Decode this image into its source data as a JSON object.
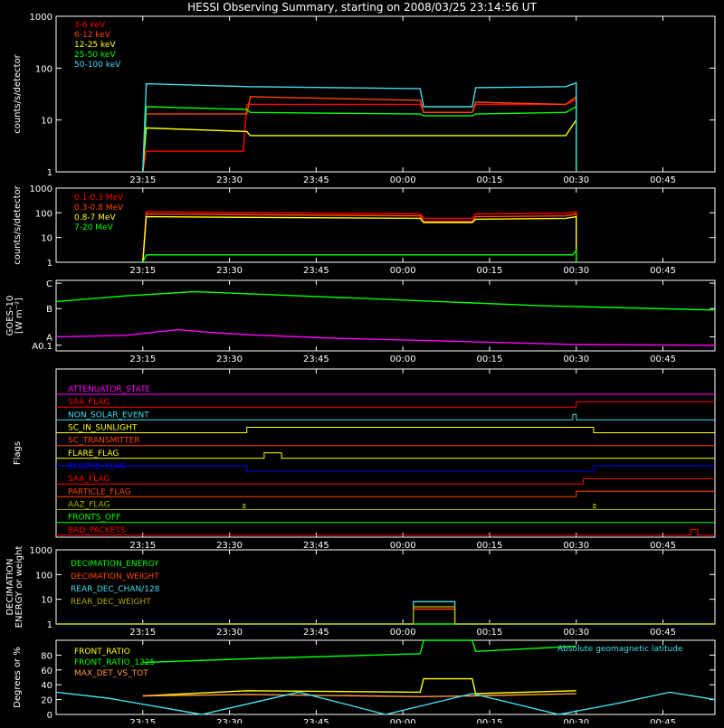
{
  "title": "HESSI Observing Summary, starting on 2008/03/25 23:14:56 UT",
  "colors": {
    "bg": "#000000",
    "axis": "#ffffff",
    "red": "#ff0000",
    "orange": "#ff6a00",
    "yellow": "#ffff00",
    "green": "#00ff00",
    "cyan": "#44ddee",
    "magenta": "#ff00ff",
    "blue": "#0000ff",
    "darkorange": "#ff4400",
    "olive": "#aaaa00",
    "brown": "#cc6600",
    "peach": "#ff9944"
  },
  "time_ticks": [
    "23:15",
    "23:30",
    "23:45",
    "00:00",
    "00:15",
    "00:30",
    "00:45"
  ],
  "chart_data": [
    {
      "type": "line",
      "panel": "lightcurves",
      "ylabel": "counts/s/detector",
      "yscale": "log",
      "ylim": [
        1,
        1000
      ],
      "y_ticks": [
        "1",
        "10",
        "100",
        "1000"
      ],
      "legend_position": "top-left",
      "series": [
        {
          "name": "3-6 keV",
          "color": "red",
          "points": [
            [
              23.25,
              1
            ],
            [
              23.26,
              2.5
            ],
            [
              23.54,
              2.5
            ],
            [
              23.55,
              20
            ],
            [
              24.05,
              20
            ],
            [
              24.06,
              14
            ],
            [
              24.2,
              14
            ],
            [
              24.21,
              20
            ],
            [
              24.47,
              20
            ],
            [
              24.5,
              25
            ],
            [
              24.5,
              1
            ]
          ]
        },
        {
          "name": "6-12 keV",
          "color": "darkorange",
          "points": [
            [
              23.25,
              1
            ],
            [
              23.26,
              13
            ],
            [
              23.55,
              13
            ],
            [
              23.56,
              28
            ],
            [
              24.05,
              24
            ],
            [
              24.06,
              14
            ],
            [
              24.2,
              14
            ],
            [
              24.21,
              22
            ],
            [
              24.47,
              20
            ],
            [
              24.5,
              28
            ],
            [
              24.5,
              1
            ]
          ]
        },
        {
          "name": "12-25 keV",
          "color": "yellow",
          "points": [
            [
              23.25,
              1
            ],
            [
              23.26,
              7
            ],
            [
              23.55,
              6
            ],
            [
              23.56,
              5
            ],
            [
              24.05,
              5
            ],
            [
              24.2,
              5
            ],
            [
              24.47,
              5
            ],
            [
              24.5,
              10
            ],
            [
              24.5,
              1
            ]
          ]
        },
        {
          "name": "25-50 keV",
          "color": "green",
          "points": [
            [
              23.25,
              1
            ],
            [
              23.26,
              18
            ],
            [
              23.55,
              16
            ],
            [
              23.56,
              14
            ],
            [
              24.05,
              13
            ],
            [
              24.06,
              12
            ],
            [
              24.2,
              12
            ],
            [
              24.21,
              13
            ],
            [
              24.47,
              14
            ],
            [
              24.5,
              18
            ],
            [
              24.5,
              1
            ]
          ]
        },
        {
          "name": "50-100 keV",
          "color": "cyan",
          "points": [
            [
              23.25,
              1
            ],
            [
              23.26,
              50
            ],
            [
              23.55,
              44
            ],
            [
              24.05,
              40
            ],
            [
              24.06,
              18
            ],
            [
              24.2,
              18
            ],
            [
              24.21,
              42
            ],
            [
              24.47,
              44
            ],
            [
              24.5,
              52
            ],
            [
              24.5,
              1
            ]
          ]
        }
      ]
    },
    {
      "type": "line",
      "panel": "high-energy",
      "ylabel": "counts/s/detector",
      "yscale": "log",
      "ylim": [
        1,
        1000
      ],
      "y_ticks": [
        "1",
        "10",
        "100",
        "1000"
      ],
      "legend_position": "top-left",
      "series": [
        {
          "name": "0.1-0.3 MeV",
          "color": "red",
          "points": [
            [
              23.25,
              1
            ],
            [
              23.26,
              110
            ],
            [
              24.05,
              90
            ],
            [
              24.06,
              60
            ],
            [
              24.2,
              60
            ],
            [
              24.21,
              90
            ],
            [
              24.47,
              95
            ],
            [
              24.5,
              110
            ],
            [
              24.5,
              1
            ]
          ]
        },
        {
          "name": "0.3-0.8 MeV",
          "color": "darkorange",
          "points": [
            [
              23.25,
              1
            ],
            [
              23.26,
              90
            ],
            [
              24.05,
              75
            ],
            [
              24.06,
              45
            ],
            [
              24.2,
              45
            ],
            [
              24.21,
              70
            ],
            [
              24.47,
              75
            ],
            [
              24.5,
              90
            ],
            [
              24.5,
              1
            ]
          ]
        },
        {
          "name": "0.8-7 MeV",
          "color": "yellow",
          "points": [
            [
              23.25,
              1
            ],
            [
              23.26,
              70
            ],
            [
              24.05,
              60
            ],
            [
              24.06,
              40
            ],
            [
              24.2,
              40
            ],
            [
              24.21,
              55
            ],
            [
              24.47,
              60
            ],
            [
              24.5,
              70
            ],
            [
              24.5,
              1
            ]
          ]
        },
        {
          "name": "7-20 MeV",
          "color": "green",
          "points": [
            [
              23.25,
              1
            ],
            [
              23.26,
              2
            ],
            [
              24.49,
              2
            ],
            [
              24.5,
              3
            ],
            [
              24.5,
              1
            ]
          ]
        }
      ]
    },
    {
      "type": "line",
      "panel": "goes",
      "ylabel": "GOES-10",
      "ylabel2": "[W m⁻²]",
      "yscale": "log",
      "y_ticks": [
        "A0.1",
        "A",
        "B",
        "C"
      ],
      "series": [
        {
          "color": "green",
          "points": [
            [
              23.0,
              5.5
            ],
            [
              23.2,
              5.9
            ],
            [
              23.4,
              6.2
            ],
            [
              23.6,
              6.0
            ],
            [
              24.0,
              5.6
            ],
            [
              24.4,
              5.2
            ],
            [
              24.9,
              4.9
            ]
          ]
        },
        {
          "color": "magenta",
          "points": [
            [
              23.0,
              3.0
            ],
            [
              23.2,
              3.1
            ],
            [
              23.35,
              3.5
            ],
            [
              23.45,
              3.3
            ],
            [
              23.55,
              3.15
            ],
            [
              23.8,
              2.9
            ],
            [
              24.2,
              2.65
            ],
            [
              24.5,
              2.45
            ],
            [
              24.9,
              2.4
            ]
          ]
        }
      ]
    },
    {
      "type": "line",
      "panel": "flags",
      "ylabel": "Flags",
      "series": [
        {
          "name": "ATTENUATOR_STATE",
          "color": "magenta",
          "points": [
            [
              23.0,
              0
            ],
            [
              24.9,
              0
            ]
          ]
        },
        {
          "name": "SAA_FLAG",
          "color": "red",
          "points": [
            [
              23.0,
              0
            ],
            [
              24.5,
              0
            ],
            [
              24.5,
              1
            ],
            [
              24.9,
              1
            ]
          ]
        },
        {
          "name": "NON_SOLAR_EVENT",
          "color": "cyan",
          "points": [
            [
              23.0,
              0
            ],
            [
              24.49,
              0
            ],
            [
              24.49,
              1
            ],
            [
              24.5,
              1
            ],
            [
              24.5,
              0
            ],
            [
              24.9,
              0
            ]
          ]
        },
        {
          "name": "SC_IN_SUNLIGHT",
          "color": "yellow",
          "points": [
            [
              23.0,
              0
            ],
            [
              23.55,
              0
            ],
            [
              23.55,
              1
            ],
            [
              24.55,
              1
            ],
            [
              24.55,
              0
            ],
            [
              24.9,
              0
            ]
          ]
        },
        {
          "name": "SC_TRANSMITTER",
          "color": "darkorange",
          "points": [
            [
              23.0,
              0
            ],
            [
              24.9,
              0
            ]
          ]
        },
        {
          "name": "FLARE_FLAG",
          "color": "yellow",
          "points": [
            [
              23.0,
              0
            ],
            [
              23.6,
              0
            ],
            [
              23.6,
              1
            ],
            [
              23.65,
              1
            ],
            [
              23.65,
              0
            ],
            [
              24.9,
              0
            ]
          ]
        },
        {
          "name": "ECLIPSE_FLAG",
          "color": "blue",
          "points": [
            [
              23.0,
              1
            ],
            [
              23.55,
              1
            ],
            [
              23.55,
              0
            ],
            [
              24.55,
              0
            ],
            [
              24.55,
              1
            ],
            [
              24.9,
              1
            ]
          ]
        },
        {
          "name": "SAA_FLAG",
          "color": "red",
          "points": [
            [
              23.0,
              0
            ],
            [
              24.52,
              0
            ],
            [
              24.52,
              1
            ],
            [
              24.9,
              1
            ]
          ]
        },
        {
          "name": "PARTICLE_FLAG",
          "color": "darkorange",
          "points": [
            [
              23.0,
              0
            ],
            [
              24.5,
              0
            ],
            [
              24.5,
              1
            ],
            [
              24.9,
              1
            ]
          ]
        },
        {
          "name": "AAZ_FLAG",
          "color": "olive",
          "points": [
            [
              23.0,
              0
            ],
            [
              23.54,
              0
            ],
            [
              23.54,
              1
            ],
            [
              23.545,
              1
            ],
            [
              23.545,
              0
            ],
            [
              24.55,
              0
            ],
            [
              24.55,
              1
            ],
            [
              24.555,
              1
            ],
            [
              24.555,
              0
            ],
            [
              24.9,
              0
            ]
          ]
        },
        {
          "name": "FRONTS_OFF",
          "color": "green",
          "points": [
            [
              23.0,
              0
            ],
            [
              24.9,
              0
            ]
          ]
        },
        {
          "name": "BAD_PACKETS",
          "color": "red",
          "points": [
            [
              23.0,
              0
            ],
            [
              24.83,
              0
            ],
            [
              24.83,
              1
            ],
            [
              24.85,
              1
            ],
            [
              24.85,
              0
            ],
            [
              24.9,
              0
            ]
          ]
        }
      ]
    },
    {
      "type": "line",
      "panel": "decimation",
      "ylabel": "DECIMATION",
      "ylabel2": "ENERGY or weight",
      "yscale": "log",
      "ylim": [
        1,
        1000
      ],
      "y_ticks": [
        "1",
        "10",
        "100",
        "1000"
      ],
      "legend_position": "top-left",
      "series": [
        {
          "name": "DECIMATION_ENERGY",
          "color": "green",
          "points": [
            [
              23.0,
              1
            ],
            [
              24.9,
              1
            ]
          ]
        },
        {
          "name": "DECIMATION_WEIGHT",
          "color": "darkorange",
          "points": [
            [
              23.0,
              1
            ],
            [
              24.03,
              1
            ],
            [
              24.03,
              4
            ],
            [
              24.15,
              4
            ],
            [
              24.15,
              1
            ],
            [
              24.9,
              1
            ]
          ]
        },
        {
          "name": "REAR_DEC_CHAN/128",
          "color": "cyan",
          "points": [
            [
              23.0,
              1
            ],
            [
              24.03,
              1
            ],
            [
              24.03,
              8
            ],
            [
              24.15,
              8
            ],
            [
              24.15,
              1
            ],
            [
              24.9,
              1
            ]
          ]
        },
        {
          "name": "REAR_DEC_WEIGHT",
          "color": "olive",
          "points": [
            [
              23.0,
              1
            ],
            [
              24.03,
              1
            ],
            [
              24.03,
              5
            ],
            [
              24.15,
              5
            ],
            [
              24.15,
              1
            ],
            [
              24.9,
              1
            ]
          ]
        }
      ]
    },
    {
      "type": "line",
      "panel": "ratios",
      "ylabel": "Degrees or %",
      "ylim": [
        0,
        100
      ],
      "y_ticks": [
        "0",
        "20",
        "40",
        "60",
        "80"
      ],
      "annotation": "Absolute geomagnetic latitude",
      "legend_position": "top-left",
      "series": [
        {
          "name": "FRONT_RATIO",
          "color": "yellow",
          "points": [
            [
              23.25,
              25
            ],
            [
              23.55,
              32
            ],
            [
              24.05,
              30
            ],
            [
              24.06,
              48
            ],
            [
              24.2,
              48
            ],
            [
              24.21,
              28
            ],
            [
              24.5,
              32
            ]
          ]
        },
        {
          "name": "FRONT_RATIO_1225",
          "color": "green",
          "points": [
            [
              23.25,
              70
            ],
            [
              23.55,
              75
            ],
            [
              24.05,
              82
            ],
            [
              24.06,
              100
            ],
            [
              24.2,
              100
            ],
            [
              24.21,
              85
            ],
            [
              24.5,
              92
            ]
          ]
        },
        {
          "name": "MAX_DET_VS_TOT",
          "color": "peach",
          "points": [
            [
              23.25,
              25
            ],
            [
              23.55,
              27
            ],
            [
              24.05,
              24
            ],
            [
              24.2,
              25
            ],
            [
              24.5,
              28
            ]
          ]
        },
        {
          "name": "Absolute geomagnetic latitude",
          "color": "cyan",
          "points": [
            [
              23.0,
              30
            ],
            [
              23.15,
              22
            ],
            [
              23.42,
              0
            ],
            [
              23.7,
              30
            ],
            [
              23.95,
              0
            ],
            [
              24.2,
              28
            ],
            [
              24.45,
              0
            ],
            [
              24.62,
              15
            ],
            [
              24.77,
              30
            ],
            [
              24.9,
              20
            ]
          ]
        }
      ]
    }
  ]
}
